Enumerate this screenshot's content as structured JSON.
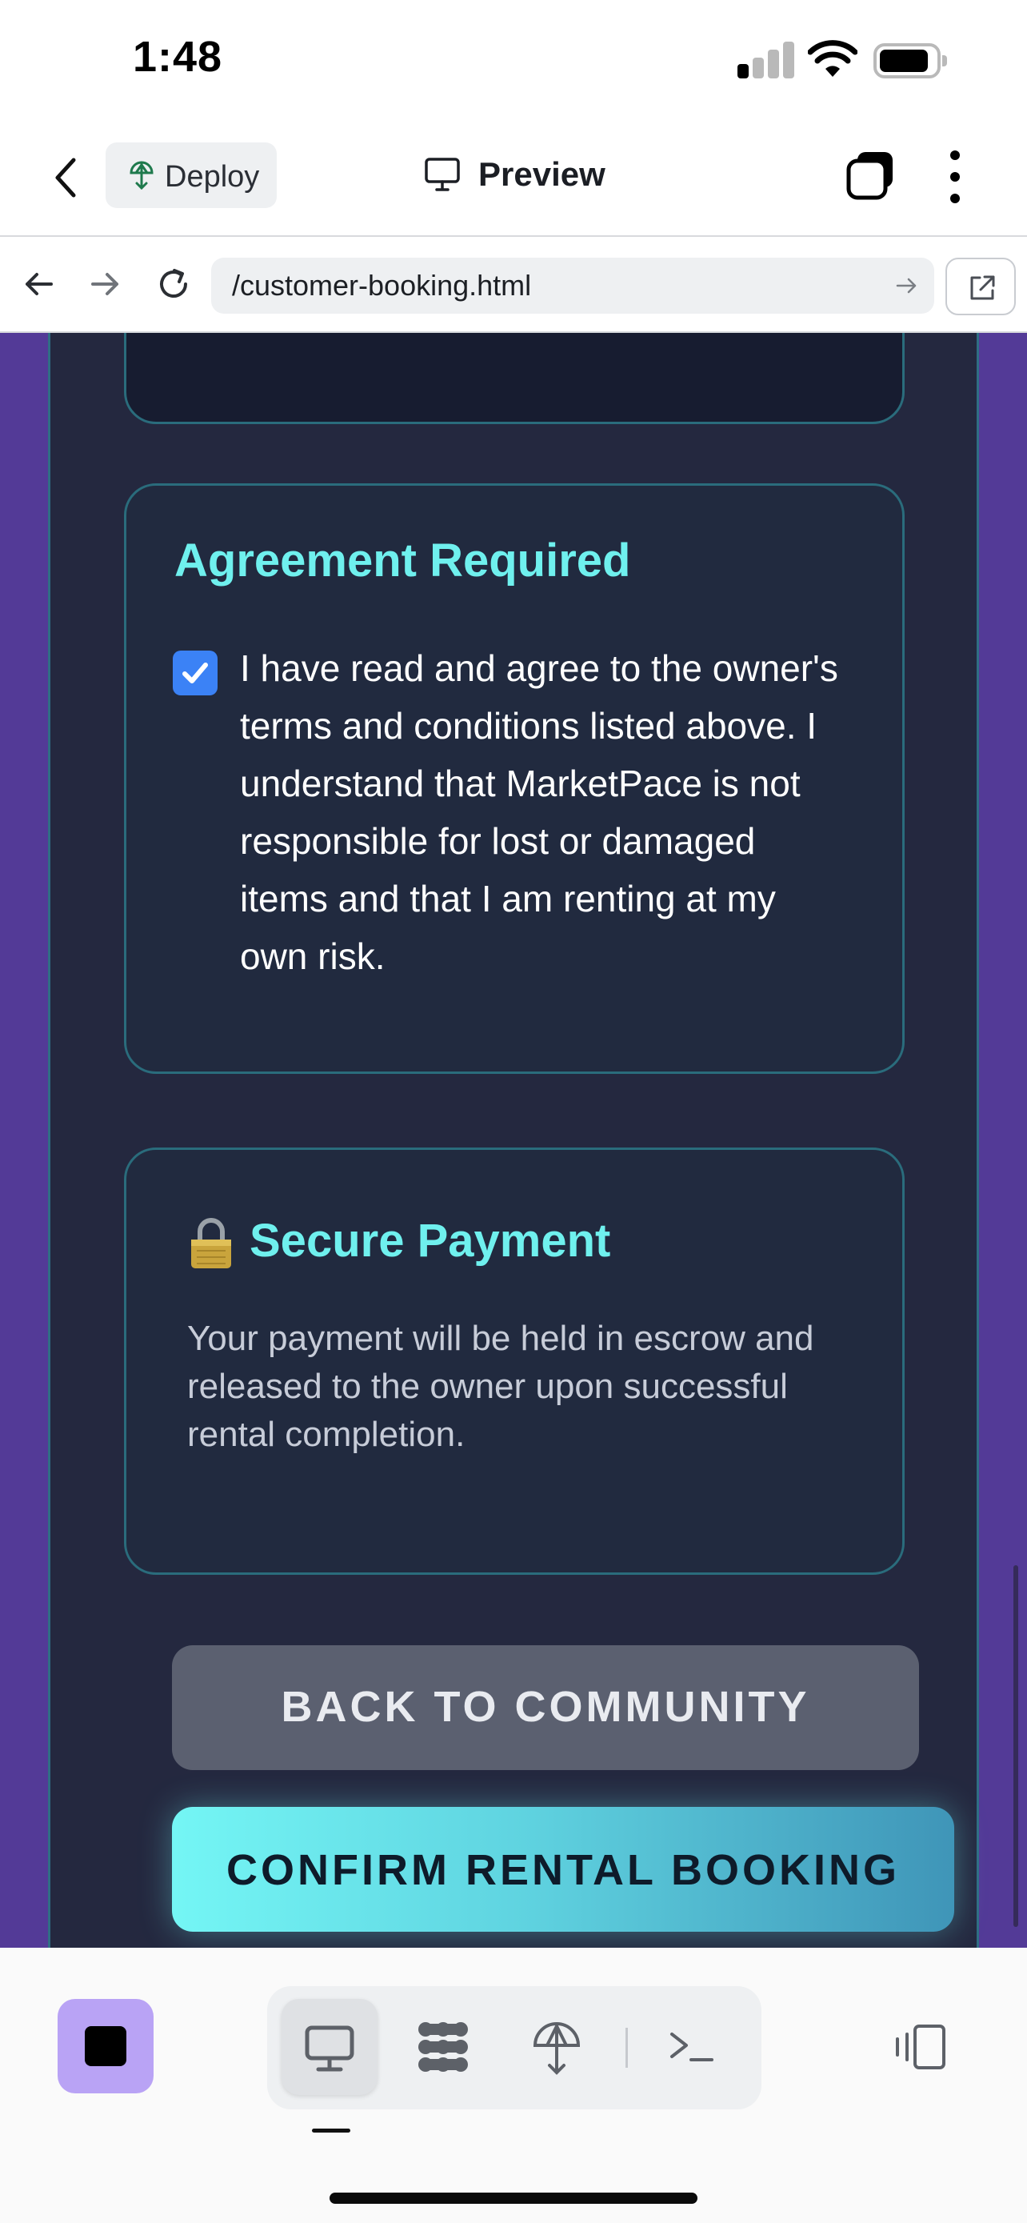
{
  "status_bar": {
    "time": "1:48"
  },
  "header": {
    "deploy_label": "Deploy",
    "preview_label": "Preview"
  },
  "url_bar": {
    "url": "/customer-booking.html"
  },
  "agreement": {
    "title": "Agreement Required",
    "checked": true,
    "text": "I have read and agree to the owner's terms and conditions listed above. I understand that MarketPace is not responsible for lost or damaged items and that I am renting at my own risk."
  },
  "secure": {
    "title": "Secure Payment",
    "icon": "lock-icon",
    "text": "Your payment will be held in escrow and released to the owner upon successful rental completion."
  },
  "buttons": {
    "back_label": "BACK TO COMMUNITY",
    "confirm_label": "CONFIRM RENTAL BOOKING"
  },
  "colors": {
    "page_bg": "#533a97",
    "panel_bg": "#24283f",
    "card_border": "#2a6c7c",
    "heading": "#6ff0ee",
    "checkbox": "#3b82f6",
    "confirm_start": "#74f6f5",
    "confirm_end": "#3f95b8",
    "back_button": "#5b6070",
    "stop_button": "#b9a3f5"
  },
  "toolbar": {
    "items": [
      "monitor-icon",
      "apps-icon",
      "deploy-icon",
      "terminal-icon"
    ],
    "active": "monitor-icon"
  }
}
